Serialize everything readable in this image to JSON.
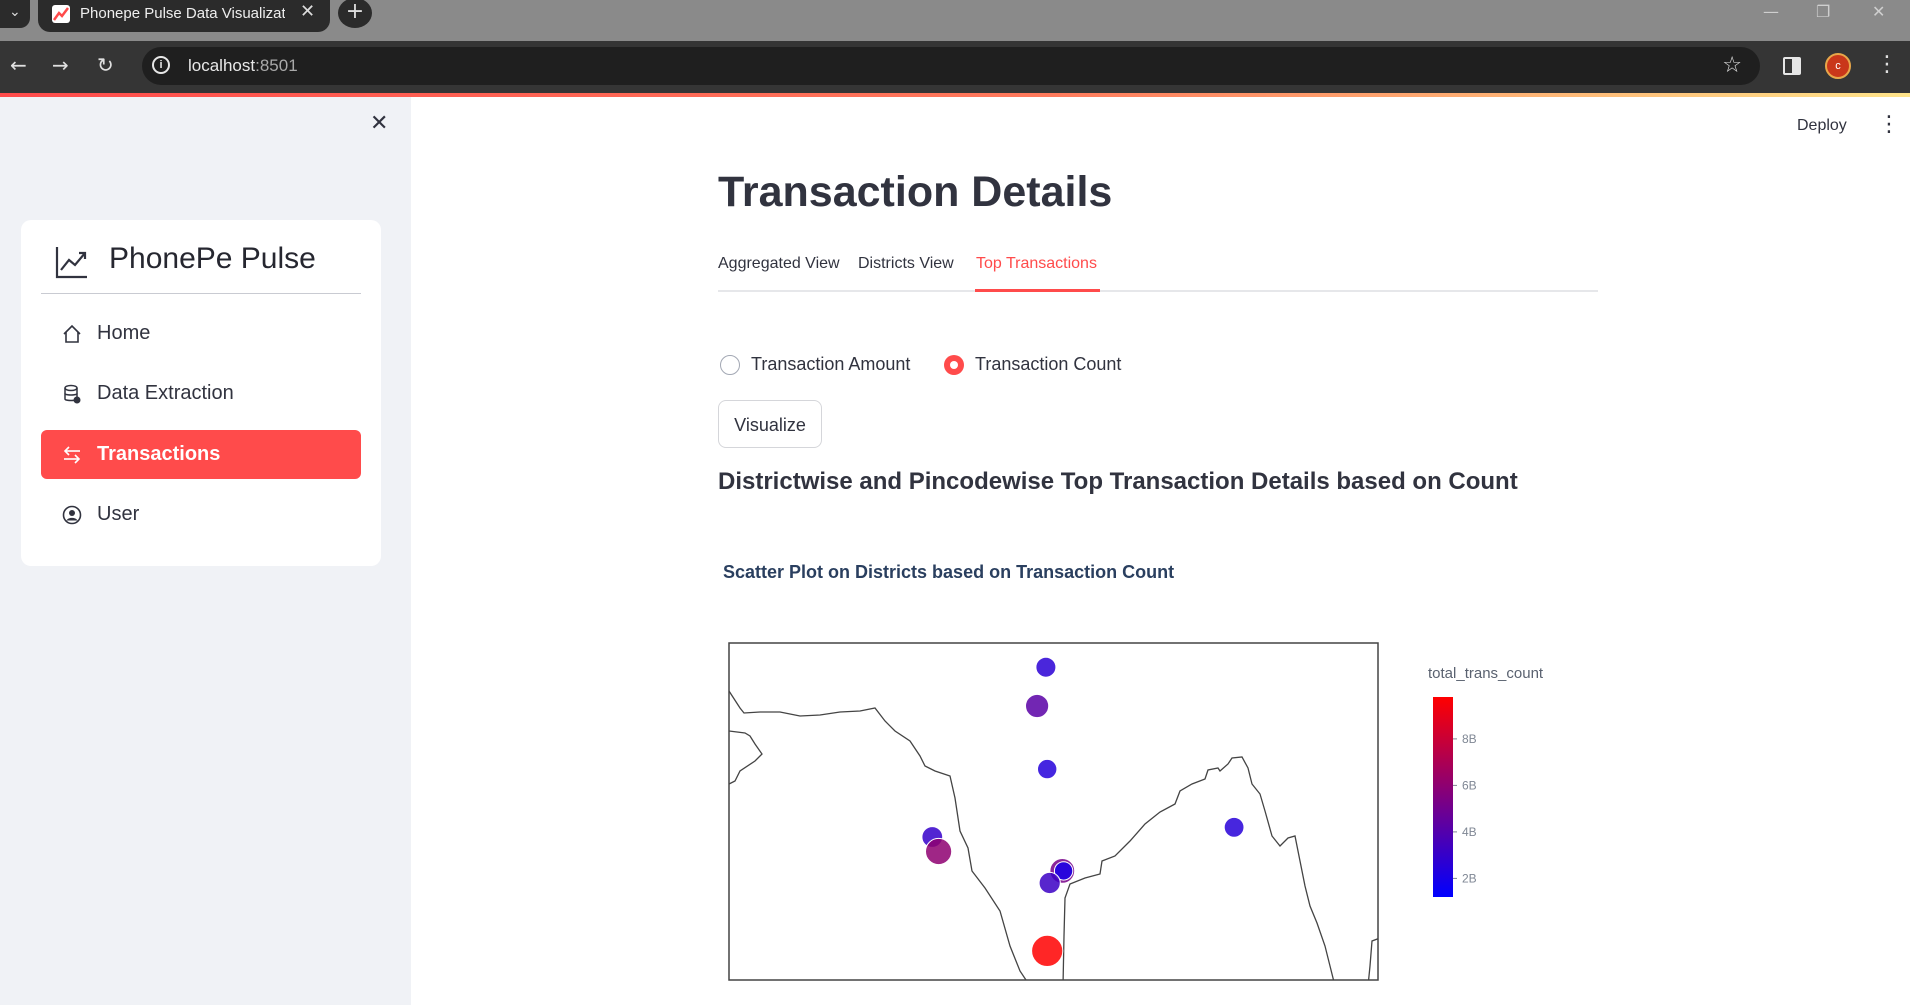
{
  "browser": {
    "tab_title": "Phonepe Pulse Data Visualizatio",
    "url_host": "localhost",
    "url_port": ":8501",
    "profile_initial": "c"
  },
  "sidebar": {
    "app_title": "PhonePe Pulse",
    "items": [
      {
        "label": "Home",
        "icon": "house-icon",
        "active": false
      },
      {
        "label": "Data Extraction",
        "icon": "database-gear-icon",
        "active": false
      },
      {
        "label": "Transactions",
        "icon": "arrow-left-right-icon",
        "active": true
      },
      {
        "label": "User",
        "icon": "person-circle-icon",
        "active": false
      }
    ],
    "accent_color": "#ff4b4b"
  },
  "header": {
    "deploy_label": "Deploy"
  },
  "main": {
    "title": "Transaction Details",
    "tabs": [
      {
        "label": "Aggregated View",
        "active": false
      },
      {
        "label": "Districts View",
        "active": false
      },
      {
        "label": "Top Transactions",
        "active": true
      }
    ],
    "radio_options": [
      {
        "label": "Transaction Amount",
        "checked": false
      },
      {
        "label": "Transaction Count",
        "checked": true
      }
    ],
    "visualize_label": "Visualize",
    "section_heading": "Districtwise and Pincodewise Top Transaction Details based on Count"
  },
  "chart_data": {
    "type": "scatter",
    "title": "Scatter Plot on Districts based on Transaction Count",
    "colorbar": {
      "title": "total_trans_count",
      "tick_labels": [
        "2B",
        "4B",
        "6B",
        "8B"
      ],
      "tick_values": [
        2,
        4,
        6,
        8
      ],
      "range": [
        1.2,
        9.8
      ],
      "colors": [
        "#0000ff",
        "#ff0000"
      ]
    },
    "points": [
      {
        "lon": 77.55,
        "lat": 32.5,
        "value": 2.6
      },
      {
        "lon": 77.2,
        "lat": 30.9,
        "value": 4.2
      },
      {
        "lon": 77.6,
        "lat": 28.3,
        "value": 2.4
      },
      {
        "lon": 85.0,
        "lat": 25.9,
        "value": 2.5
      },
      {
        "lon": 73.05,
        "lat": 25.5,
        "value": 3.0
      },
      {
        "lon": 73.3,
        "lat": 24.9,
        "value": 6.0
      },
      {
        "lon": 78.2,
        "lat": 24.1,
        "value": 5.2
      },
      {
        "lon": 78.25,
        "lat": 24.1,
        "value": 2.0
      },
      {
        "lon": 77.7,
        "lat": 23.6,
        "value": 3.2
      },
      {
        "lon": 77.6,
        "lat": 20.8,
        "value": 9.8
      }
    ]
  }
}
